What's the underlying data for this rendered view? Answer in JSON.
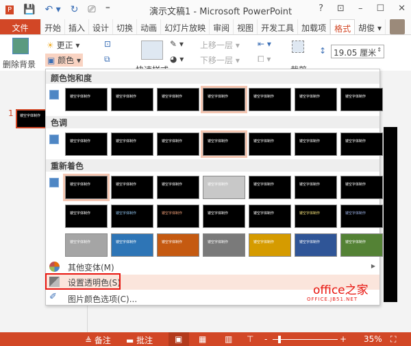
{
  "titlebar": {
    "title": "演示文稿1 - Microsoft PowerPoint",
    "help": "?",
    "restore": "⊡",
    "minimize": "–",
    "maximize": "☐",
    "close": "✕",
    "quick_access": [
      "P",
      "💾",
      "↶ ▾",
      "↻",
      "⎚",
      "⁼"
    ]
  },
  "tabs": [
    "文件",
    "开始",
    "插入",
    "设计",
    "切换",
    "动画",
    "幻灯片放映",
    "审阅",
    "视图",
    "开发工具",
    "加载项",
    "格式",
    "胡俊 ▾"
  ],
  "active_tab": "格式",
  "ribbon": {
    "remove_bg": "删除背景",
    "corrections": "更正 ▾",
    "color": "颜色 ▾",
    "quick_styles": "快速样式",
    "bring_forward": "上移一层 ▾",
    "send_backward": "下移一层 ▾",
    "crop": "裁剪",
    "height": "19.05 厘米"
  },
  "slide_panel": {
    "number": "1",
    "thumb_text": "镂空字体制作"
  },
  "menu": {
    "sections": [
      {
        "title": "颜色饱和度",
        "rows": [
          [
            {
              "bg": "#000000",
              "fg": "#ffffff"
            },
            {
              "bg": "#000000",
              "fg": "#ffffff"
            },
            {
              "bg": "#000000",
              "fg": "#ffffff"
            },
            {
              "bg": "#000000",
              "fg": "#ffffff",
              "selected": true
            },
            {
              "bg": "#000000",
              "fg": "#ffffff"
            },
            {
              "bg": "#000000",
              "fg": "#ffffff"
            },
            {
              "bg": "#000000",
              "fg": "#ffffff"
            }
          ]
        ]
      },
      {
        "title": "色调",
        "rows": [
          [
            {
              "bg": "#000000",
              "fg": "#ffffff"
            },
            {
              "bg": "#000000",
              "fg": "#ffffff"
            },
            {
              "bg": "#000000",
              "fg": "#ffffff"
            },
            {
              "bg": "#000000",
              "fg": "#ffffff",
              "selected": true
            },
            {
              "bg": "#000000",
              "fg": "#ffffff"
            },
            {
              "bg": "#000000",
              "fg": "#ffffff"
            },
            {
              "bg": "#000000",
              "fg": "#ffffff"
            }
          ]
        ]
      },
      {
        "title": "重新着色",
        "rows": [
          [
            {
              "bg": "#000000",
              "fg": "#ffffff",
              "selected": true
            },
            {
              "bg": "#000000",
              "fg": "#ffffff"
            },
            {
              "bg": "#000000",
              "fg": "#ffffff"
            },
            {
              "bg": "#c8c8c8",
              "fg": "#ffffff"
            },
            {
              "bg": "#000000",
              "fg": "#ffffff"
            },
            {
              "bg": "#000000",
              "fg": "#ffffff"
            },
            {
              "bg": "#000000",
              "fg": "#ffffff"
            }
          ],
          [
            {
              "bg": "#000000",
              "fg": "#ffffff"
            },
            {
              "bg": "#000000",
              "fg": "#8fc3ef"
            },
            {
              "bg": "#000000",
              "fg": "#f4a27a"
            },
            {
              "bg": "#000000",
              "fg": "#ffffff"
            },
            {
              "bg": "#000000",
              "fg": "#ffffff"
            },
            {
              "bg": "#000000",
              "fg": "#f5e27a"
            },
            {
              "bg": "#000000",
              "fg": "#9eb4ea"
            }
          ],
          [
            {
              "bg": "#a5a5a5",
              "fg": "#ffffff"
            },
            {
              "bg": "#2e75b6",
              "fg": "#ffffff"
            },
            {
              "bg": "#c55a11",
              "fg": "#ffffff"
            },
            {
              "bg": "#7a7a7a",
              "fg": "#ffffff"
            },
            {
              "bg": "#d59b00",
              "fg": "#ffffff"
            },
            {
              "bg": "#2f5597",
              "fg": "#ffffff"
            },
            {
              "bg": "#548235",
              "fg": "#ffffff"
            }
          ]
        ]
      }
    ],
    "thumb_text": "镂空字体制作",
    "more_variations": "其他变体(M)",
    "set_transparent": "设置透明色(S)",
    "color_options": "图片颜色选项(C)..."
  },
  "watermark": {
    "line1": "office之家",
    "line2": "OFFICE.JB51.NET"
  },
  "status": {
    "notes": "≜ 备注",
    "comments": "▬ 批注",
    "zoom": "35%",
    "minus": "-",
    "plus": "+"
  }
}
